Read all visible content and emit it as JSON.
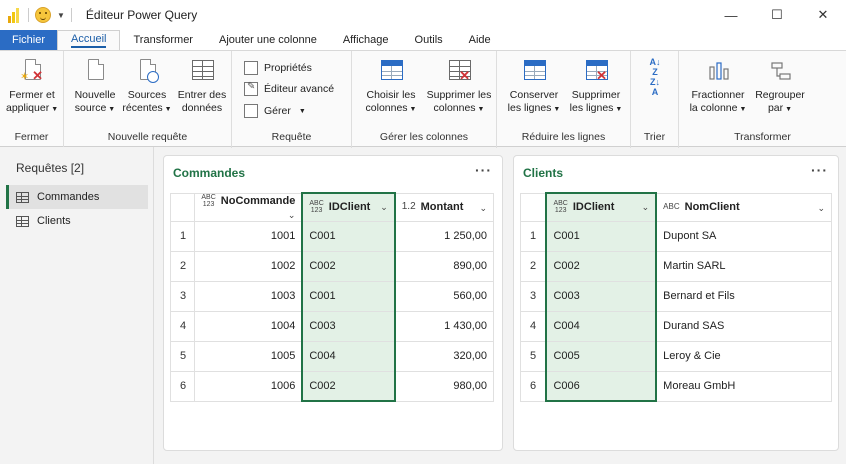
{
  "window": {
    "title": "Éditeur Power Query",
    "controls": {
      "minimize": "—",
      "maximize": "☐",
      "close": "✕"
    }
  },
  "tabs": [
    "Fichier",
    "Accueil",
    "Transformer",
    "Ajouter une colonne",
    "Affichage",
    "Outils",
    "Aide"
  ],
  "ribbon": {
    "fermer": {
      "label": "Fermer",
      "btn1": "Fermer et",
      "btn2": "appliquer"
    },
    "nouvelle_requete": {
      "label": "Nouvelle requête",
      "nouvelle_source": [
        "Nouvelle",
        "source"
      ],
      "sources_recentes": [
        "Sources",
        "récentes"
      ],
      "entrer_donnees": [
        "Entrer des",
        "données"
      ]
    },
    "requete": {
      "label": "Requête",
      "proprietes": "Propriétés",
      "editeur": "Éditeur avancé",
      "gerer": "Gérer"
    },
    "gerer_colonnes": {
      "label": "Gérer les colonnes",
      "choisir": [
        "Choisir les",
        "colonnes"
      ],
      "supprimer": [
        "Supprimer les",
        "colonnes"
      ]
    },
    "reduire_lignes": {
      "label": "Réduire les lignes",
      "conserver": [
        "Conserver",
        "les lignes"
      ],
      "supprimer": [
        "Supprimer",
        "les lignes"
      ]
    },
    "trier": {
      "label": "Trier"
    },
    "transformer": {
      "label": "Transformer",
      "fractionner": [
        "Fractionner",
        "la colonne"
      ],
      "regrouper": [
        "Regrouper",
        "par"
      ]
    }
  },
  "sidebar": {
    "title": "Requêtes [2]",
    "items": [
      {
        "label": "Commandes",
        "selected": true
      },
      {
        "label": "Clients",
        "selected": false
      }
    ]
  },
  "commandes": {
    "title": "Commandes",
    "columns": [
      {
        "type": "ABC\n123",
        "name": "NoCommande"
      },
      {
        "type": "ABC\n123",
        "name": "IDClient"
      },
      {
        "type": "1.2",
        "name": "Montant"
      }
    ],
    "rows": [
      [
        "1",
        "1001",
        "C001",
        "1 250,00"
      ],
      [
        "2",
        "1002",
        "C002",
        "890,00"
      ],
      [
        "3",
        "1003",
        "C001",
        "560,00"
      ],
      [
        "4",
        "1004",
        "C003",
        "1 430,00"
      ],
      [
        "5",
        "1005",
        "C004",
        "320,00"
      ],
      [
        "6",
        "1006",
        "C002",
        "980,00"
      ]
    ]
  },
  "clients": {
    "title": "Clients",
    "columns": [
      {
        "type": "ABC\n123",
        "name": "IDClient"
      },
      {
        "type": "ABC",
        "name": "NomClient"
      }
    ],
    "rows": [
      [
        "1",
        "C001",
        "Dupont SA"
      ],
      [
        "2",
        "C002",
        "Martin SARL"
      ],
      [
        "3",
        "C003",
        "Bernard et Fils"
      ],
      [
        "4",
        "C004",
        "Durand SAS"
      ],
      [
        "5",
        "C005",
        "Leroy & Cie"
      ],
      [
        "6",
        "C006",
        "Moreau GmbH"
      ]
    ]
  },
  "colors": {
    "accent": "#217346",
    "file_tab": "#2b6cc4",
    "highlight": "#e3f1e6"
  }
}
